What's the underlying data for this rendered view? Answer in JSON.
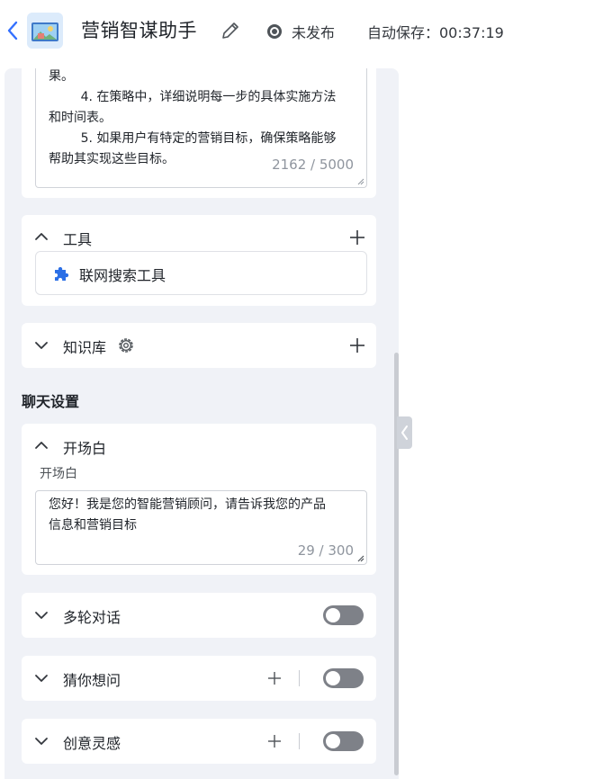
{
  "header": {
    "title": "营销智谋助手",
    "status": "未发布",
    "autosave": "自动保存：00:37:19",
    "icons": [
      "back-arrow-icon",
      "edit-pencil-icon",
      "status-dot-icon"
    ]
  },
  "prompt_box": {
    "lines": "果。\n        4. 在策略中，详细说明每一步的具体实施方法\n和时间表。\n        5. 如果用户有特定的营销目标，确保策略能够\n帮助其实现这些目标。",
    "counter": "2162 / 5000"
  },
  "tools": {
    "label": "工具",
    "item": "联网搜索工具"
  },
  "knowledge": {
    "label": "知识库"
  },
  "chat_settings": {
    "heading": "聊天设置",
    "opening": {
      "label": "开场白",
      "sub_label": "开场白",
      "text": "您好！我是您的智能营销顾问，请告诉我您的产品\n信息和营销目标",
      "counter": "29 / 300"
    },
    "multi_turn": {
      "label": "多轮对话",
      "enabled": false
    },
    "guess": {
      "label": "猜你想问",
      "enabled": false
    },
    "inspiration": {
      "label": "创意灵感",
      "enabled": false
    }
  },
  "colors": {
    "accent": "#3370ff",
    "panel_bg": "#f0f2f7",
    "toggle_off": "#7e8188"
  }
}
